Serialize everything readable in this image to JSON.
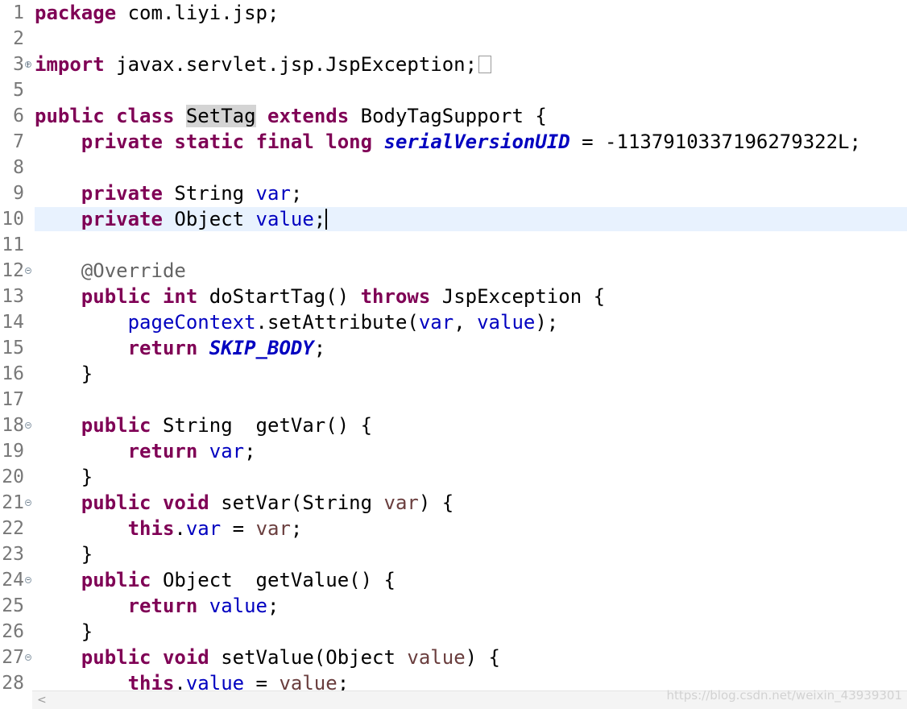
{
  "editor": {
    "line_numbers": [
      "1",
      "2",
      "3",
      "5",
      "6",
      "7",
      "8",
      "9",
      "10",
      "11",
      "12",
      "13",
      "14",
      "15",
      "16",
      "17",
      "18",
      "19",
      "20",
      "21",
      "22",
      "23",
      "24",
      "25",
      "26",
      "27",
      "28"
    ],
    "current_line": "10",
    "colors": {
      "keyword": "#7f0055",
      "field": "#0000c0",
      "parameter": "#6a3e3e",
      "annotation": "#646464",
      "current_line_bg": "#e8f2fe",
      "occurrence_bg": "#d4d4d4"
    },
    "tokens": {
      "package": "package",
      "package_name": " com.liyi.jsp;",
      "import": "import",
      "import_name": " javax.servlet.jsp.JspException;",
      "public": "public",
      "class": "class",
      "class_name": "SetTag",
      "extends": "extends",
      "superclass": " BodyTagSupport {",
      "private": "private",
      "static": "static",
      "final": "final",
      "long": "long",
      "serial_name": "serialVersionUID",
      "serial_value": " = -1137910337196279322L;",
      "string_type": " String ",
      "object_type": " Object ",
      "var": "var",
      "value": "value",
      "semicolon": ";",
      "override": "@Override",
      "int": "int",
      "do_start_sig": " doStartTag() ",
      "throws": "throws",
      "jsp_exception": " JspException {",
      "page_context": "pageContext",
      "set_attribute": ".setAttribute(",
      "comma_space": ", ",
      "close_paren_semi": ");",
      "return": "return",
      "skip_body": "SKIP_BODY",
      "close_brace": "}",
      "get_var_sig": " getVar() {",
      "void": "void",
      "set_var_open": " setVar(String ",
      "close_paren_brace": ") {",
      "this": "this",
      "dot": ".",
      "assign": " = ",
      "get_value_sig": " getValue() {",
      "set_value_open": " setValue(Object "
    }
  },
  "scrollbar": {
    "left_arrow": "<"
  },
  "watermark": "https://blog.csdn.net/weixin_43939301"
}
